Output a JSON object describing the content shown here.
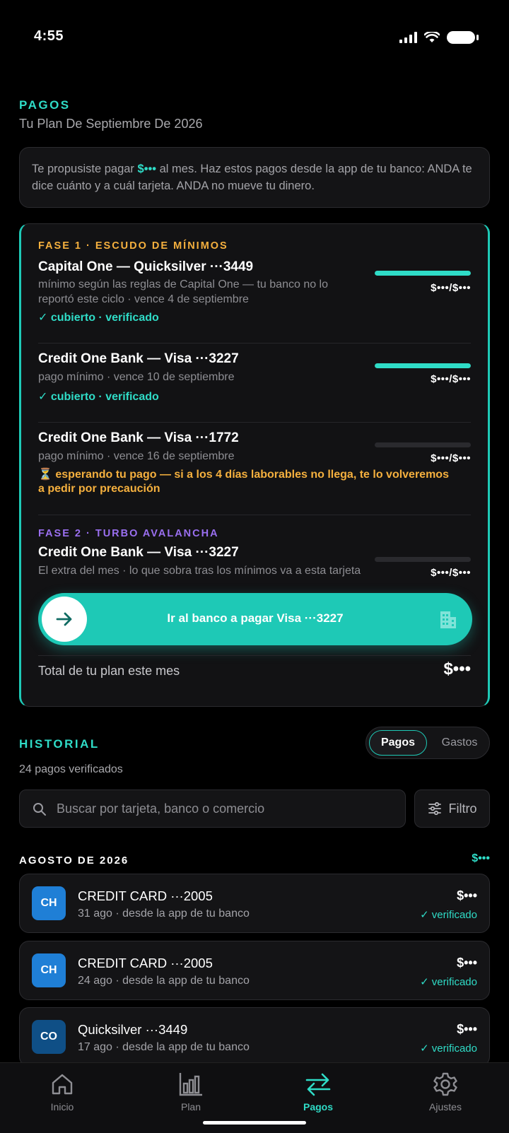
{
  "status": {
    "time": "4:55"
  },
  "header": {
    "section": "PAGOS",
    "subtitle": "Tu Plan De Septiembre De 2026"
  },
  "note": {
    "before": "Te propusiste pagar ",
    "amount": "$•••",
    "after": " al mes. Haz estos pagos desde la app de tu banco: ANDA te dice cuánto y a cuál tarjeta. ANDA no mueve tu dinero."
  },
  "plan": {
    "phase1_label": "FASE 1 · ESCUDO DE MÍNIMOS",
    "cards": [
      {
        "title": "Capital One — Quicksilver ···3449",
        "desc": "mínimo según las reglas de Capital One — tu banco no lo reportó este ciclo · vence 4 de septiembre",
        "status": "✓ cubierto · verificado",
        "amount": "$•••/$•••",
        "progress": 1.0
      },
      {
        "title": "Credit One Bank — Visa ···3227",
        "desc": "pago mínimo · vence 10 de septiembre",
        "status": "✓ cubierto · verificado",
        "amount": "$•••/$•••",
        "progress": 1.0
      },
      {
        "title": "Credit One Bank — Visa ···1772",
        "desc": "pago mínimo · vence 16 de septiembre",
        "status": "⏳ esperando tu pago — si a los 4 días laborables no llega, te lo volveremos a pedir por precaución",
        "amount": "$•••/$•••",
        "progress": 0.0
      }
    ],
    "phase2_label": "FASE 2 · TURBO AVALANCHA",
    "turbo": {
      "title": "Credit One Bank — Visa ···3227",
      "desc": "El extra del mes · lo que sobra tras los mínimos va a esta tarjeta",
      "amount": "$•••/$•••",
      "progress": 0.0
    },
    "cta_label": "Ir al banco a pagar Visa ···3227",
    "total_label": "Total de tu plan este mes",
    "total_value": "$•••"
  },
  "history": {
    "section": "HISTORIAL",
    "count": "24 pagos verificados",
    "toggle": {
      "active": "Pagos",
      "inactive": "Gastos"
    },
    "search_placeholder": "Buscar por tarjeta, banco o comercio",
    "filter_label": "Filtro",
    "month": "AGOSTO DE 2026",
    "month_total": "$•••",
    "items": [
      {
        "badge": "CH",
        "badge_color": "#1f7fd6",
        "title": "CREDIT CARD ···2005",
        "sub": "31 ago · desde la app de tu banco",
        "amount": "$•••",
        "status": "✓ verificado"
      },
      {
        "badge": "CH",
        "badge_color": "#1f7fd6",
        "title": "CREDIT CARD ···2005",
        "sub": "24 ago · desde la app de tu banco",
        "amount": "$•••",
        "status": "✓ verificado"
      },
      {
        "badge": "CO",
        "badge_color": "#0f4f86",
        "title": "Quicksilver ···3449",
        "sub": "17 ago · desde la app de tu banco",
        "amount": "$•••",
        "status": "✓ verificado"
      }
    ]
  },
  "tabs": [
    {
      "label": "Inicio",
      "icon": "home-icon"
    },
    {
      "label": "Plan",
      "icon": "bar-chart-icon"
    },
    {
      "label": "Pagos",
      "icon": "transfer-icon",
      "active": true
    },
    {
      "label": "Ajustes",
      "icon": "gear-icon"
    }
  ],
  "colors": {
    "accent": "#1ec9b6",
    "phase1": "#f5b03e",
    "phase2": "#9a6ff0",
    "background": "#000000"
  }
}
